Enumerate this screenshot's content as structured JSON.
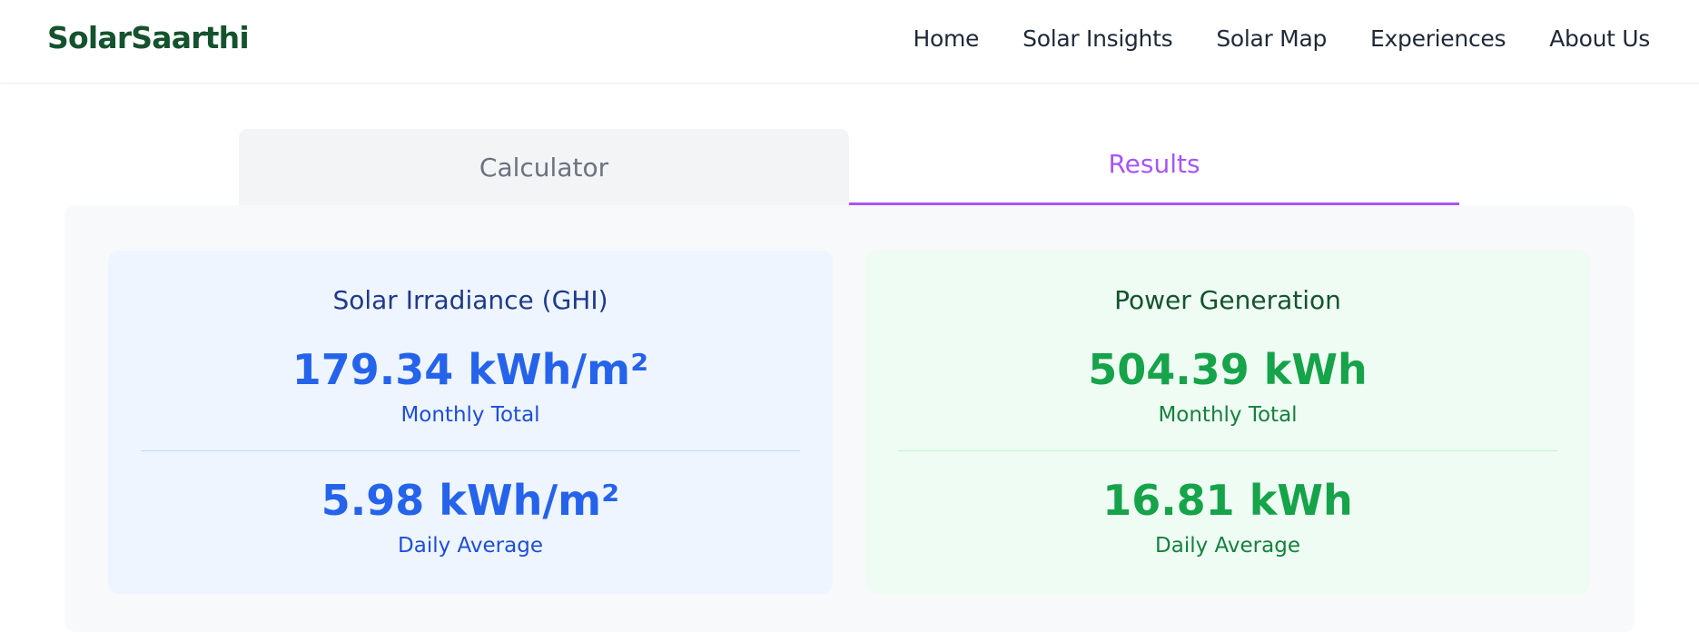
{
  "brand": {
    "name": "SolarSaarthi"
  },
  "nav": {
    "items": [
      {
        "label": "Home"
      },
      {
        "label": "Solar Insights"
      },
      {
        "label": "Solar Map"
      },
      {
        "label": "Experiences"
      },
      {
        "label": "About Us"
      }
    ]
  },
  "tabs": {
    "calculator": "Calculator",
    "results": "Results",
    "active": "Results"
  },
  "results": {
    "irradiance": {
      "title": "Solar Irradiance (GHI)",
      "monthly_value": "179.34 kWh/m²",
      "monthly_label": "Monthly Total",
      "daily_value": "5.98 kWh/m²",
      "daily_label": "Daily Average"
    },
    "power": {
      "title": "Power Generation",
      "monthly_value": "504.39 kWh",
      "monthly_label": "Monthly Total",
      "daily_value": "16.81 kWh",
      "daily_label": "Daily Average"
    }
  },
  "colors": {
    "brand": "#14532d",
    "accent": "#a855f7",
    "irradiance_value": "#2563eb",
    "power_value": "#16a34a"
  }
}
